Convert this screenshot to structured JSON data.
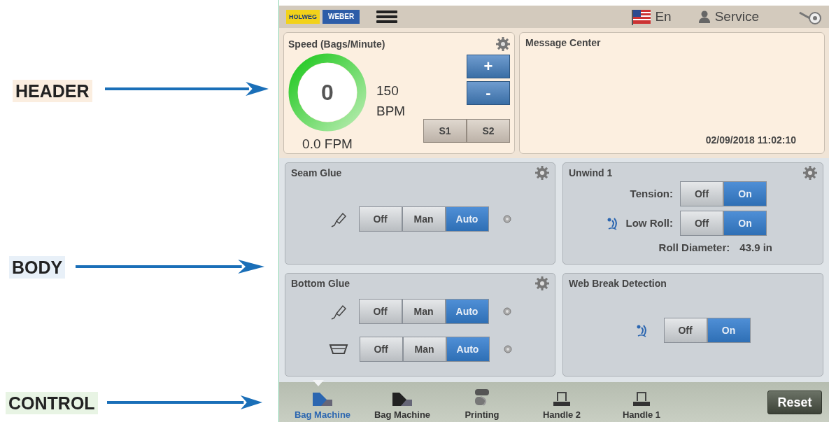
{
  "annotations": [
    {
      "label": "HEADER",
      "color": "#fbeee0"
    },
    {
      "label": "BODY",
      "color": "#e8f0f8"
    },
    {
      "label": "CONTROL",
      "color": "#e8f4e4"
    }
  ],
  "top_bar": {
    "logo": [
      "HOLWEG",
      "WEBER"
    ],
    "language": "En",
    "user": "Service"
  },
  "speed": {
    "title": "Speed (Bags/Minute)",
    "value": "0",
    "fpm": "0.0 FPM",
    "bpm": "150 BPM",
    "adjust": [
      "+",
      "-"
    ],
    "presets": [
      "S1",
      "S2"
    ]
  },
  "message_center": {
    "title": "Message Center",
    "timestamp": "02/09/2018 11:02:10"
  },
  "panels": [
    {
      "title": "Seam Glue",
      "settings": true,
      "rows": [
        {
          "kind": "glue",
          "options": [
            {
              "label": "Off",
              "selected": false
            },
            {
              "label": "Man",
              "selected": false
            },
            {
              "label": "Auto",
              "selected": true
            }
          ]
        }
      ]
    },
    {
      "title": "Unwind 1",
      "settings": true,
      "rows": [
        {
          "kind": "plain",
          "label": "Tension:",
          "options": [
            {
              "label": "Off",
              "selected": false
            },
            {
              "label": "On",
              "selected": true
            }
          ]
        },
        {
          "kind": "sensor",
          "label": "Low Roll:",
          "options": [
            {
              "label": "Off",
              "selected": false
            },
            {
              "label": "On",
              "selected": true
            }
          ]
        }
      ],
      "readout": {
        "label": "Roll Diameter:",
        "value": "43.9 in"
      }
    },
    {
      "title": "Bottom Glue",
      "settings": true,
      "rows": [
        {
          "kind": "glue",
          "options": [
            {
              "label": "Off",
              "selected": false
            },
            {
              "label": "Man",
              "selected": false
            },
            {
              "label": "Auto",
              "selected": true
            }
          ]
        },
        {
          "kind": "tray",
          "options": [
            {
              "label": "Off",
              "selected": false
            },
            {
              "label": "Man",
              "selected": false
            },
            {
              "label": "Auto",
              "selected": true
            }
          ]
        }
      ]
    },
    {
      "title": "Web Break Detection",
      "settings": false,
      "rows": [
        {
          "kind": "sensor",
          "options": [
            {
              "label": "Off",
              "selected": false
            },
            {
              "label": "On",
              "selected": true
            }
          ]
        }
      ]
    }
  ],
  "nav": [
    {
      "label": "Bag Machine",
      "kind": "bag",
      "selected": true
    },
    {
      "label": "Bag Machine",
      "kind": "bag",
      "selected": false
    },
    {
      "label": "Printing",
      "kind": "printing",
      "selected": false
    },
    {
      "label": "Handle 2",
      "kind": "handle",
      "selected": false
    },
    {
      "label": "Handle 1",
      "kind": "handle",
      "selected": false
    }
  ],
  "reset": "Reset"
}
